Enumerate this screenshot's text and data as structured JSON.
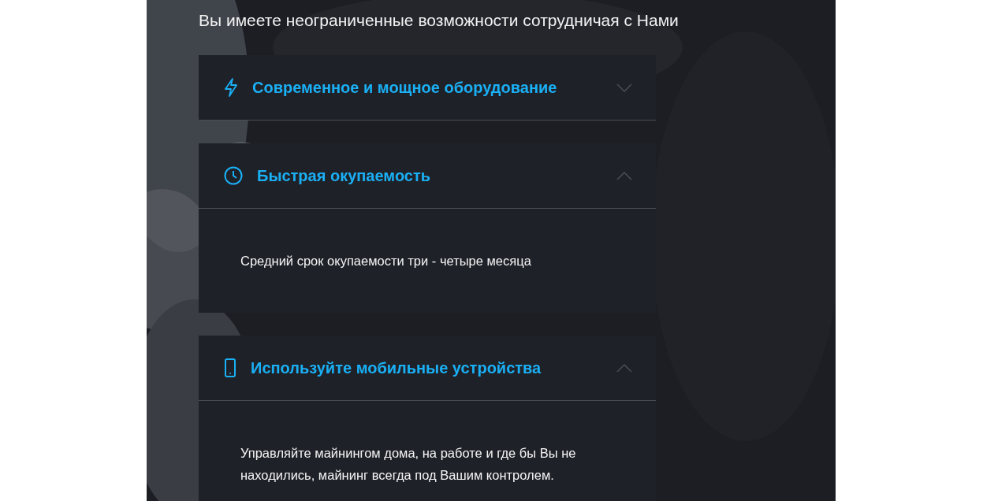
{
  "heading": "Вы имеете неограниченные возможности сотрудничая с Нами",
  "accordion": [
    {
      "title": "Современное и мощное оборудование",
      "expanded": false
    },
    {
      "title": "Быстрая окупаемость",
      "expanded": true,
      "body": "Средний срок окупаемости три - четыре месяца"
    },
    {
      "title": "Используйте мобильные устройства",
      "expanded": true,
      "body": "Управляйте майнингом дома, на работе и где бы Вы не находились, майнинг всегда под Вашим контролем."
    }
  ]
}
